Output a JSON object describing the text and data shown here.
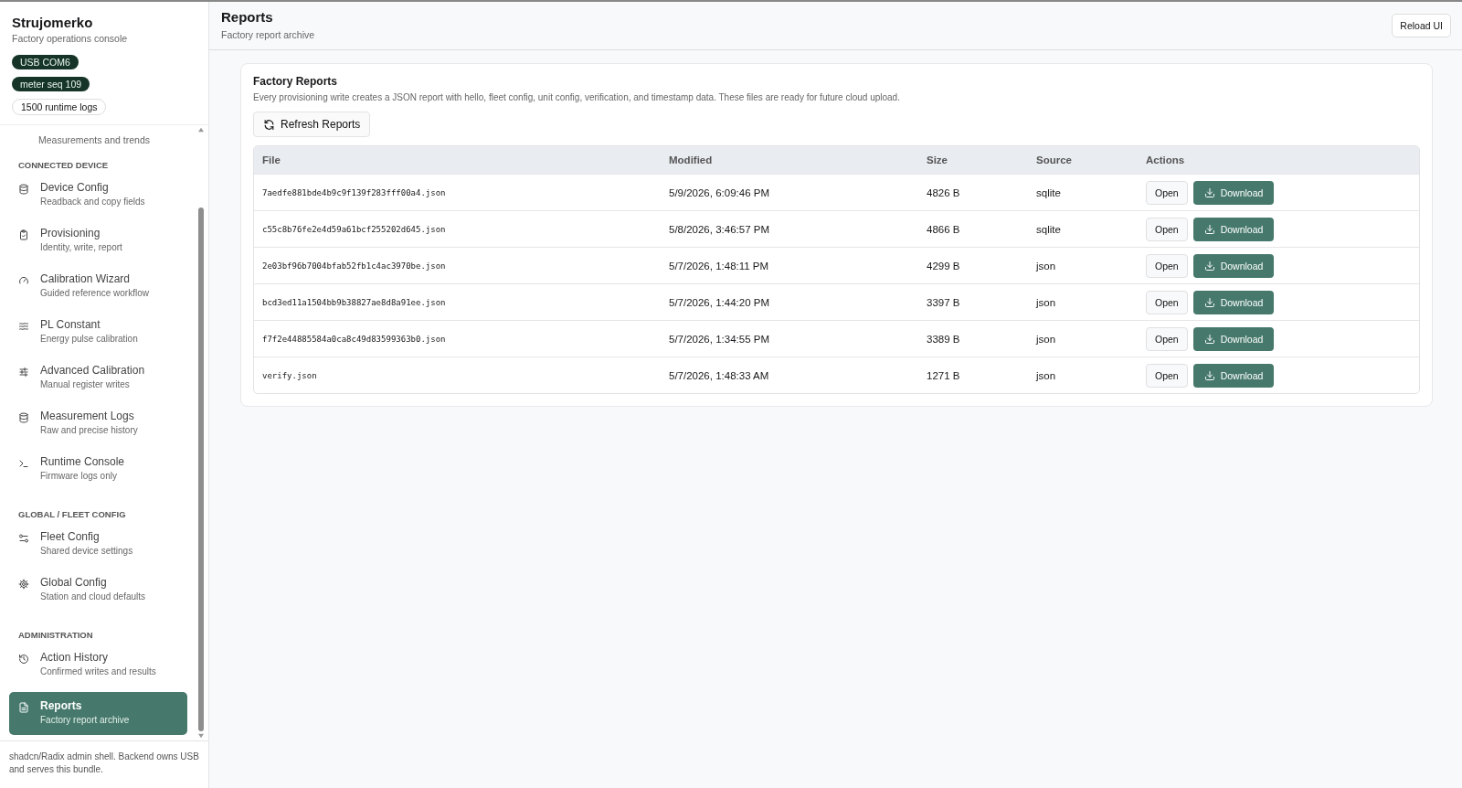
{
  "brand": {
    "title": "Strujomerko",
    "subtitle": "Factory operations console"
  },
  "badges": [
    {
      "label": "USB COM6",
      "kind": "dark"
    },
    {
      "label": "meter seq 109",
      "kind": "dark"
    },
    {
      "label": "1500 runtime logs",
      "kind": "outline"
    }
  ],
  "nav": [
    {
      "kind": "partial",
      "subtitle": "Measurements and trends"
    },
    {
      "kind": "section",
      "title": "CONNECTED DEVICE"
    },
    {
      "kind": "item",
      "title": "Device Config",
      "subtitle": "Readback and copy fields",
      "selected": false
    },
    {
      "kind": "item",
      "title": "Provisioning",
      "subtitle": "Identity, write, report",
      "selected": false
    },
    {
      "kind": "item",
      "title": "Calibration Wizard",
      "subtitle": "Guided reference workflow",
      "selected": false
    },
    {
      "kind": "item",
      "title": "PL Constant",
      "subtitle": "Energy pulse calibration",
      "selected": false
    },
    {
      "kind": "item",
      "title": "Advanced Calibration",
      "subtitle": "Manual register writes",
      "selected": false
    },
    {
      "kind": "item",
      "title": "Measurement Logs",
      "subtitle": "Raw and precise history",
      "selected": false
    },
    {
      "kind": "item",
      "title": "Runtime Console",
      "subtitle": "Firmware logs only",
      "selected": false
    },
    {
      "kind": "section",
      "title": "GLOBAL / FLEET CONFIG"
    },
    {
      "kind": "item",
      "title": "Fleet Config",
      "subtitle": "Shared device settings",
      "selected": false
    },
    {
      "kind": "item",
      "title": "Global Config",
      "subtitle": "Station and cloud defaults",
      "selected": false
    },
    {
      "kind": "section",
      "title": "ADMINISTRATION"
    },
    {
      "kind": "item",
      "title": "Action History",
      "subtitle": "Confirmed writes and results",
      "selected": false
    },
    {
      "kind": "item",
      "title": "Reports",
      "subtitle": "Factory report archive",
      "selected": true
    }
  ],
  "sidebar_footer": "shadcn/Radix admin shell. Backend owns USB and serves this bundle.",
  "header": {
    "title": "Reports",
    "subtitle": "Factory report archive",
    "button": "Reload UI"
  },
  "card": {
    "title": "Factory Reports",
    "description": "Every provisioning write creates a JSON report with hello, fleet config, unit config, verification, and timestamp data. These files are ready for future cloud upload.",
    "refresh_button": "Refresh Reports",
    "table": {
      "columns": [
        "File",
        "Modified",
        "Size",
        "Source",
        "Actions"
      ],
      "rows": [
        {
          "file": "7aedfe881bde4b9c9f139f283fff00a4.json",
          "modified": "5/9/2026, 6:09:46 PM",
          "size": "4826 B",
          "source": "sqlite",
          "open": "Open",
          "download": "Download"
        },
        {
          "file": "c55c8b76fe2e4d59a61bcf255202d645.json",
          "modified": "5/8/2026, 3:46:57 PM",
          "size": "4866 B",
          "source": "sqlite",
          "open": "Open",
          "download": "Download"
        },
        {
          "file": "2e03bf96b7004bfab52fb1c4ac3970be.json",
          "modified": "5/7/2026, 1:48:11 PM",
          "size": "4299 B",
          "source": "json",
          "open": "Open",
          "download": "Download"
        },
        {
          "file": "bcd3ed11a1504bb9b38827ae8d8a91ee.json",
          "modified": "5/7/2026, 1:44:20 PM",
          "size": "3397 B",
          "source": "json",
          "open": "Open",
          "download": "Download"
        },
        {
          "file": "f7f2e44885584a0ca8c49d83599363b0.json",
          "modified": "5/7/2026, 1:34:55 PM",
          "size": "3389 B",
          "source": "json",
          "open": "Open",
          "download": "Download"
        },
        {
          "file": "verify.json",
          "modified": "5/7/2026, 1:48:33 AM",
          "size": "1271 B",
          "source": "json",
          "open": "Open",
          "download": "Download"
        }
      ]
    }
  }
}
